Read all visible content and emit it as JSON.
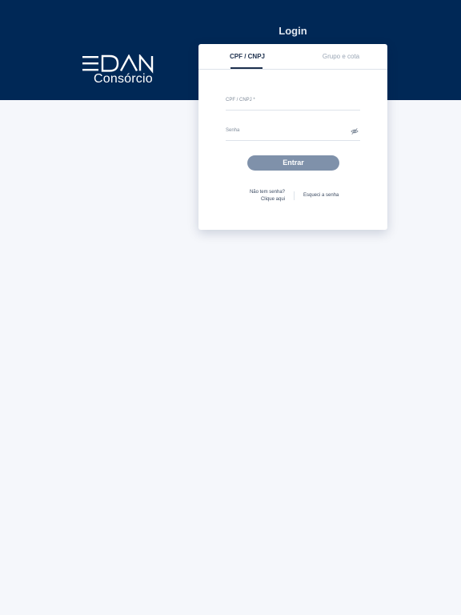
{
  "header": {
    "title": "Login",
    "logo": {
      "brand": "EDAN",
      "subtitle": "Consórcio"
    }
  },
  "colors": {
    "header_bg": "#002856",
    "page_bg": "#f5f7fb",
    "button_bg": "#7f91aa",
    "tab_active": "#1c2f4d"
  },
  "tabs": [
    {
      "label": "CPF / CNPJ",
      "active": true
    },
    {
      "label": "Grupo e cota",
      "active": false
    }
  ],
  "form": {
    "cpf_label": "CPF / CNPJ *",
    "cpf_value": "",
    "senha_label": "Senha",
    "senha_value": "",
    "password_toggle_icon": "eye-off-icon",
    "submit_label": "Entrar"
  },
  "links": {
    "no_password_line1": "Não tem senha?",
    "no_password_line2": "Clique aqui",
    "forgot_password": "Esqueci a senha"
  }
}
